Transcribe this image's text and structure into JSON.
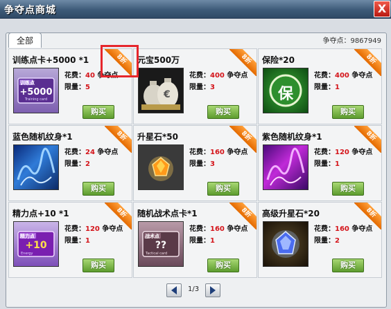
{
  "window": {
    "title": "争夺点商城",
    "close_glyph": "X"
  },
  "tabs": [
    {
      "label": "全部"
    }
  ],
  "currency": {
    "label": "争夺点：",
    "value": "9867949"
  },
  "labels": {
    "cost": "花费：",
    "currency_unit": "争夺点",
    "limit": "限量：",
    "buy": "购买",
    "discount": "8折"
  },
  "items": [
    {
      "name": "训练点卡+5000 *1",
      "cost": "40",
      "limit": "5",
      "thumb_text": "+5000",
      "thumb_top": "训练点",
      "thumb_sub": "Training card"
    },
    {
      "name": "元宝500万",
      "cost": "400",
      "limit": "3",
      "thumb_text": "€"
    },
    {
      "name": "保险*20",
      "cost": "400",
      "limit": "1",
      "thumb_text": "保"
    },
    {
      "name": "蓝色随机纹身*1",
      "cost": "24",
      "limit": "2",
      "thumb_text": ""
    },
    {
      "name": "升星石*50",
      "cost": "160",
      "limit": "3",
      "thumb_text": ""
    },
    {
      "name": "紫色随机纹身*1",
      "cost": "120",
      "limit": "1",
      "thumb_text": ""
    },
    {
      "name": "精力点+10  *1",
      "cost": "120",
      "limit": "1",
      "thumb_text": "+10",
      "thumb_top": "精力点",
      "thumb_sub": "Energy"
    },
    {
      "name": "随机战术点卡*1",
      "cost": "160",
      "limit": "1",
      "thumb_text": "??",
      "thumb_top": "战术点",
      "thumb_sub": "Tactical card"
    },
    {
      "name": "高级升星石*20",
      "cost": "160",
      "limit": "2",
      "thumb_text": ""
    }
  ],
  "pagination": {
    "text": "1/3"
  },
  "colors": {
    "price_red": "#d4141a",
    "ribbon": "#f08a1a",
    "buy_green": "#6aa83a",
    "highlight": "#e6262c"
  }
}
